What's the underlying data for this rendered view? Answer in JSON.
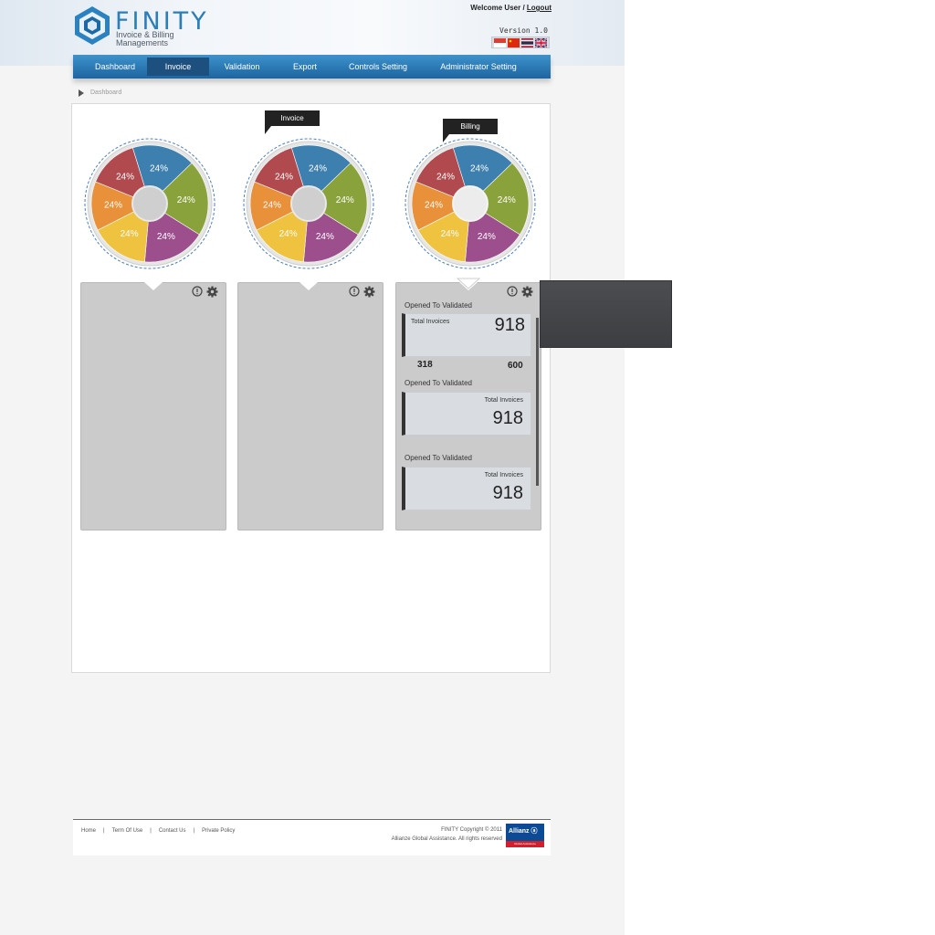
{
  "header": {
    "brand": "FINITY",
    "tagline_line1": "Invoice & Billing",
    "tagline_line2": "Managements",
    "welcome_text": "Welcome User / ",
    "logout_label": "Logout",
    "version": "Version 1.0",
    "languages": [
      "singapore-flag",
      "china-flag",
      "thailand-flag",
      "uk-flag"
    ]
  },
  "nav": {
    "items": [
      {
        "label": "Dashboard",
        "active": false
      },
      {
        "label": "Invoice",
        "active": true
      },
      {
        "label": "Validation",
        "active": false
      },
      {
        "label": "Export",
        "active": false
      },
      {
        "label": "Controls Setting",
        "active": false
      },
      {
        "label": "Administrator Setting",
        "active": false
      }
    ]
  },
  "breadcrumb": {
    "label": "Dashboard"
  },
  "charts": [
    {
      "tag": "",
      "slices": [
        "24%",
        "24%",
        "24%",
        "24%",
        "24%",
        "24%"
      ]
    },
    {
      "tag": "Invoice",
      "slices": [
        "24%",
        "24%",
        "24%",
        "24%",
        "24%",
        "24%"
      ]
    },
    {
      "tag": "Billing",
      "slices": [
        "24%",
        "24%",
        "24%",
        "24%",
        "24%",
        "24%"
      ]
    }
  ],
  "colors": {
    "blue": "#3d7fae",
    "green": "#8aa23b",
    "purple": "#9c4e8d",
    "yellow": "#efc23f",
    "orange": "#e8913a",
    "red": "#b14a4e",
    "nav": "#2b79b4"
  },
  "stats_panel": {
    "blocks": [
      {
        "title": "Opened To  Validated",
        "label": "Total Invoices",
        "value": "918",
        "sub_left": "318",
        "sub_right": "600"
      },
      {
        "title": "Opened To  Validated",
        "label": "Total Invoices",
        "value": "918"
      },
      {
        "title": "Opened To  Validated",
        "label": "Total Invoices",
        "value": "918"
      }
    ]
  },
  "footer": {
    "links": [
      "Home",
      "|",
      "Term Of Use",
      "|",
      "Contact Us",
      "|",
      "Private Policy"
    ],
    "copyright_line1": "FINITY Copyright © 2011",
    "copyright_line2": "Allianze Global Assistance. All rights reserved",
    "partner_logo": "Allianz ⓐ",
    "partner_sub": "Global Assistance"
  }
}
